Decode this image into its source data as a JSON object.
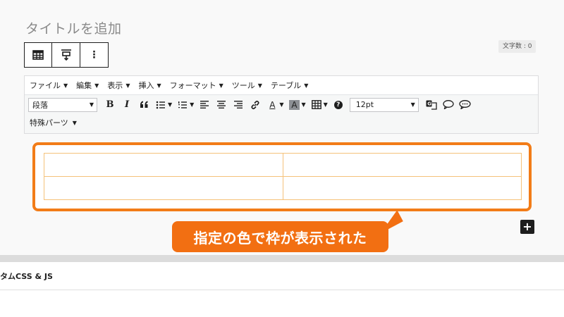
{
  "post_title_placeholder": "タイトルを追加",
  "char_count": "文字数 : 0",
  "block_toolbar": {
    "icons": [
      "table-block-icon",
      "align-vertical-icon",
      "more-options-icon"
    ],
    "more_label": "⋮"
  },
  "menubar": {
    "items": [
      {
        "label": "ファイル"
      },
      {
        "label": "編集"
      },
      {
        "label": "表示"
      },
      {
        "label": "挿入"
      },
      {
        "label": "フォーマット"
      },
      {
        "label": "ツール"
      },
      {
        "label": "テーブル"
      }
    ]
  },
  "toolbar": {
    "format_value": "段落",
    "bold": "B",
    "italic": "I",
    "quote": "66",
    "font_size_value": "12pt",
    "text_color_letter": "A",
    "bg_color_letter": "A",
    "help": "?",
    "special_parts": "特殊パーツ"
  },
  "table": {
    "rows": 2,
    "cols": 2,
    "border_color": "#f5c27a"
  },
  "callout": {
    "text": "指定の色で枠が表示された",
    "color": "#f26f12"
  },
  "add_block_label": "+",
  "meta_panel": {
    "title": "タムCSS & JS"
  },
  "colors": {
    "frame_highlight": "#f27c18",
    "background": "#f9f9f9"
  }
}
